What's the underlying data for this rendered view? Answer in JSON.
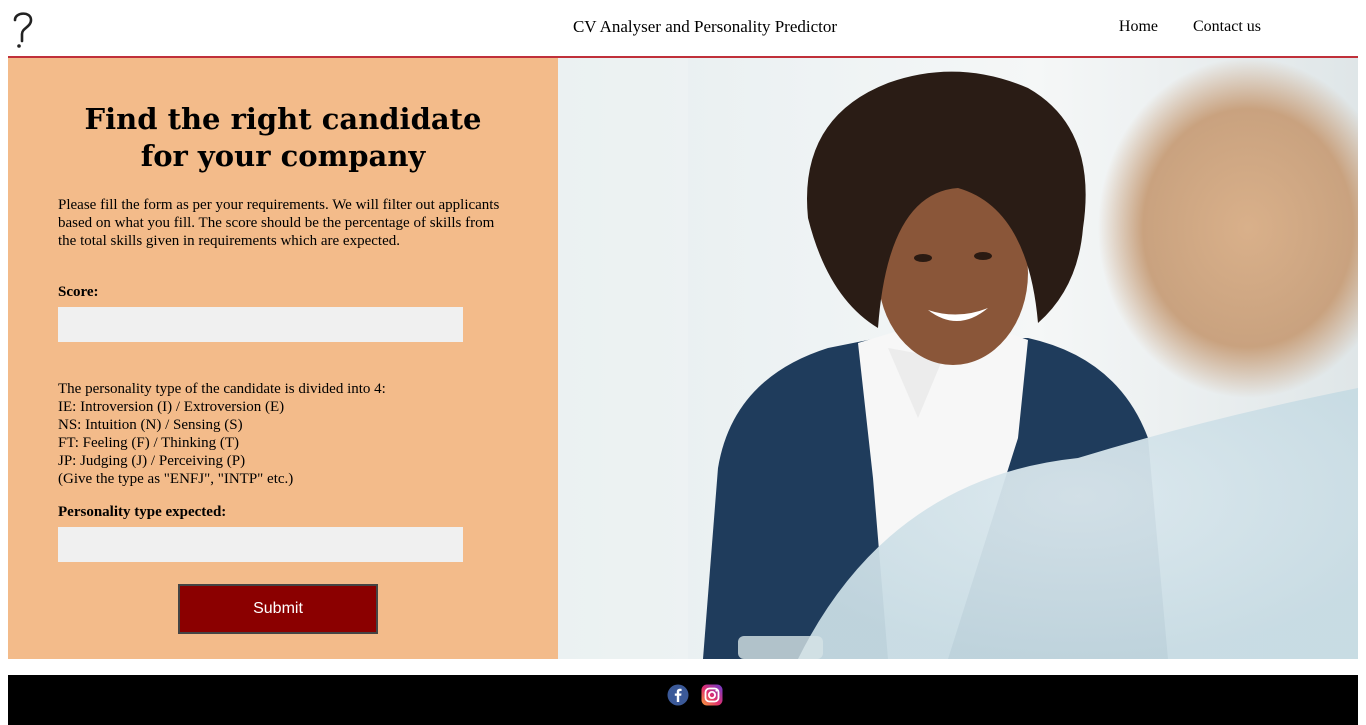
{
  "header": {
    "title": "CV Analyser and Personality Predictor",
    "nav": {
      "home": "Home",
      "contact": "Contact us"
    }
  },
  "form": {
    "heading": "Find the right candidate for your company",
    "intro": "Please fill the form as per your requirements. We will filter out applicants based on what you fill. The score should be the percentage of skills from the total skills given in requirements which are expected.",
    "score_label": "Score:",
    "score_value": "",
    "personality_lines": [
      "The personality type of the candidate is divided into 4:",
      "IE: Introversion (I) / Extroversion (E)",
      "NS: Intuition (N) / Sensing (S)",
      "FT: Feeling (F) / Thinking (T)",
      "JP: Judging (J) / Perceiving (P)",
      "(Give the type as \"ENFJ\", \"INTP\" etc.)"
    ],
    "personality_label": "Personality type expected:",
    "personality_value": "",
    "submit_label": "Submit"
  },
  "colors": {
    "panel": "#f3bb8a",
    "accent_rule": "#c0303a",
    "submit": "#8b0000",
    "footer": "#000000"
  },
  "footer": {
    "icons": [
      "facebook-icon",
      "instagram-icon"
    ]
  }
}
